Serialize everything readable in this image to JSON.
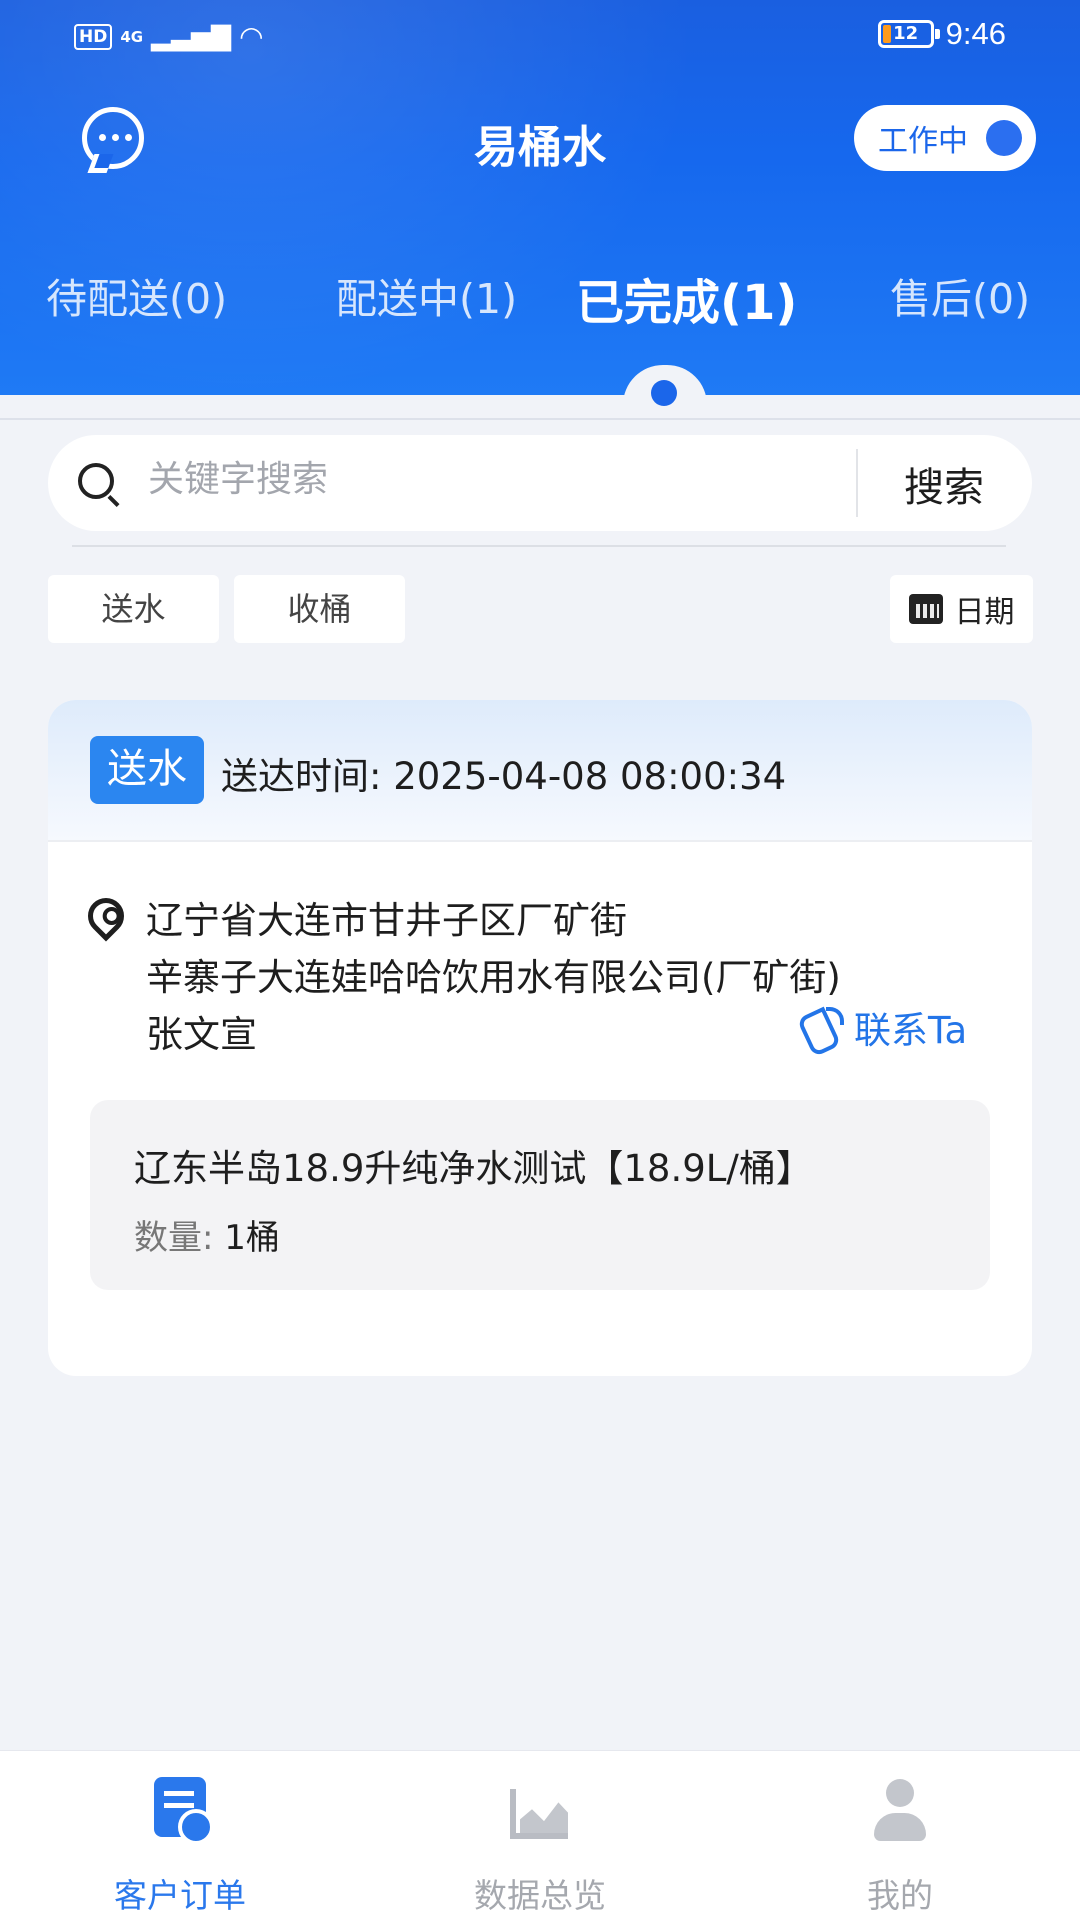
{
  "status_bar": {
    "hd": "HD",
    "network": "4G",
    "battery": "12",
    "time": "9:46"
  },
  "header": {
    "title": "易桶水",
    "work_status": "工作中"
  },
  "tabs": [
    {
      "label": "待配送(0)"
    },
    {
      "label": "配送中(1)"
    },
    {
      "label": "已完成(1)"
    },
    {
      "label": "售后(0)"
    }
  ],
  "active_tab": "已完成(1)",
  "search": {
    "placeholder": "关键字搜索",
    "button": "搜索",
    "value": ""
  },
  "filters": {
    "chips": [
      "送水",
      "收桶"
    ],
    "date_label": "日期"
  },
  "order": {
    "type": "送水",
    "delivered_time": "送达时间: 2025-04-08 08:00:34",
    "address_line1": "辽宁省大连市甘井子区厂矿街",
    "address_line2": "辛寨子大连娃哈哈饮用水有限公司(厂矿街)",
    "customer": "张文宣",
    "contact_label": "联系Ta",
    "product_name": "辽东半岛18.9升纯净水测试【18.9L/桶】",
    "quantity_label": "数量:",
    "quantity_value": "1桶"
  },
  "bottom_nav": [
    {
      "label": "客户订单",
      "icon": "order-icon",
      "active": true
    },
    {
      "label": "数据总览",
      "icon": "chart-icon",
      "active": false
    },
    {
      "label": "我的",
      "icon": "user-icon",
      "active": false
    }
  ],
  "colors": {
    "primary": "#1b66ea",
    "accent_blue": "#2a78ec",
    "background": "#f1f3f8"
  }
}
